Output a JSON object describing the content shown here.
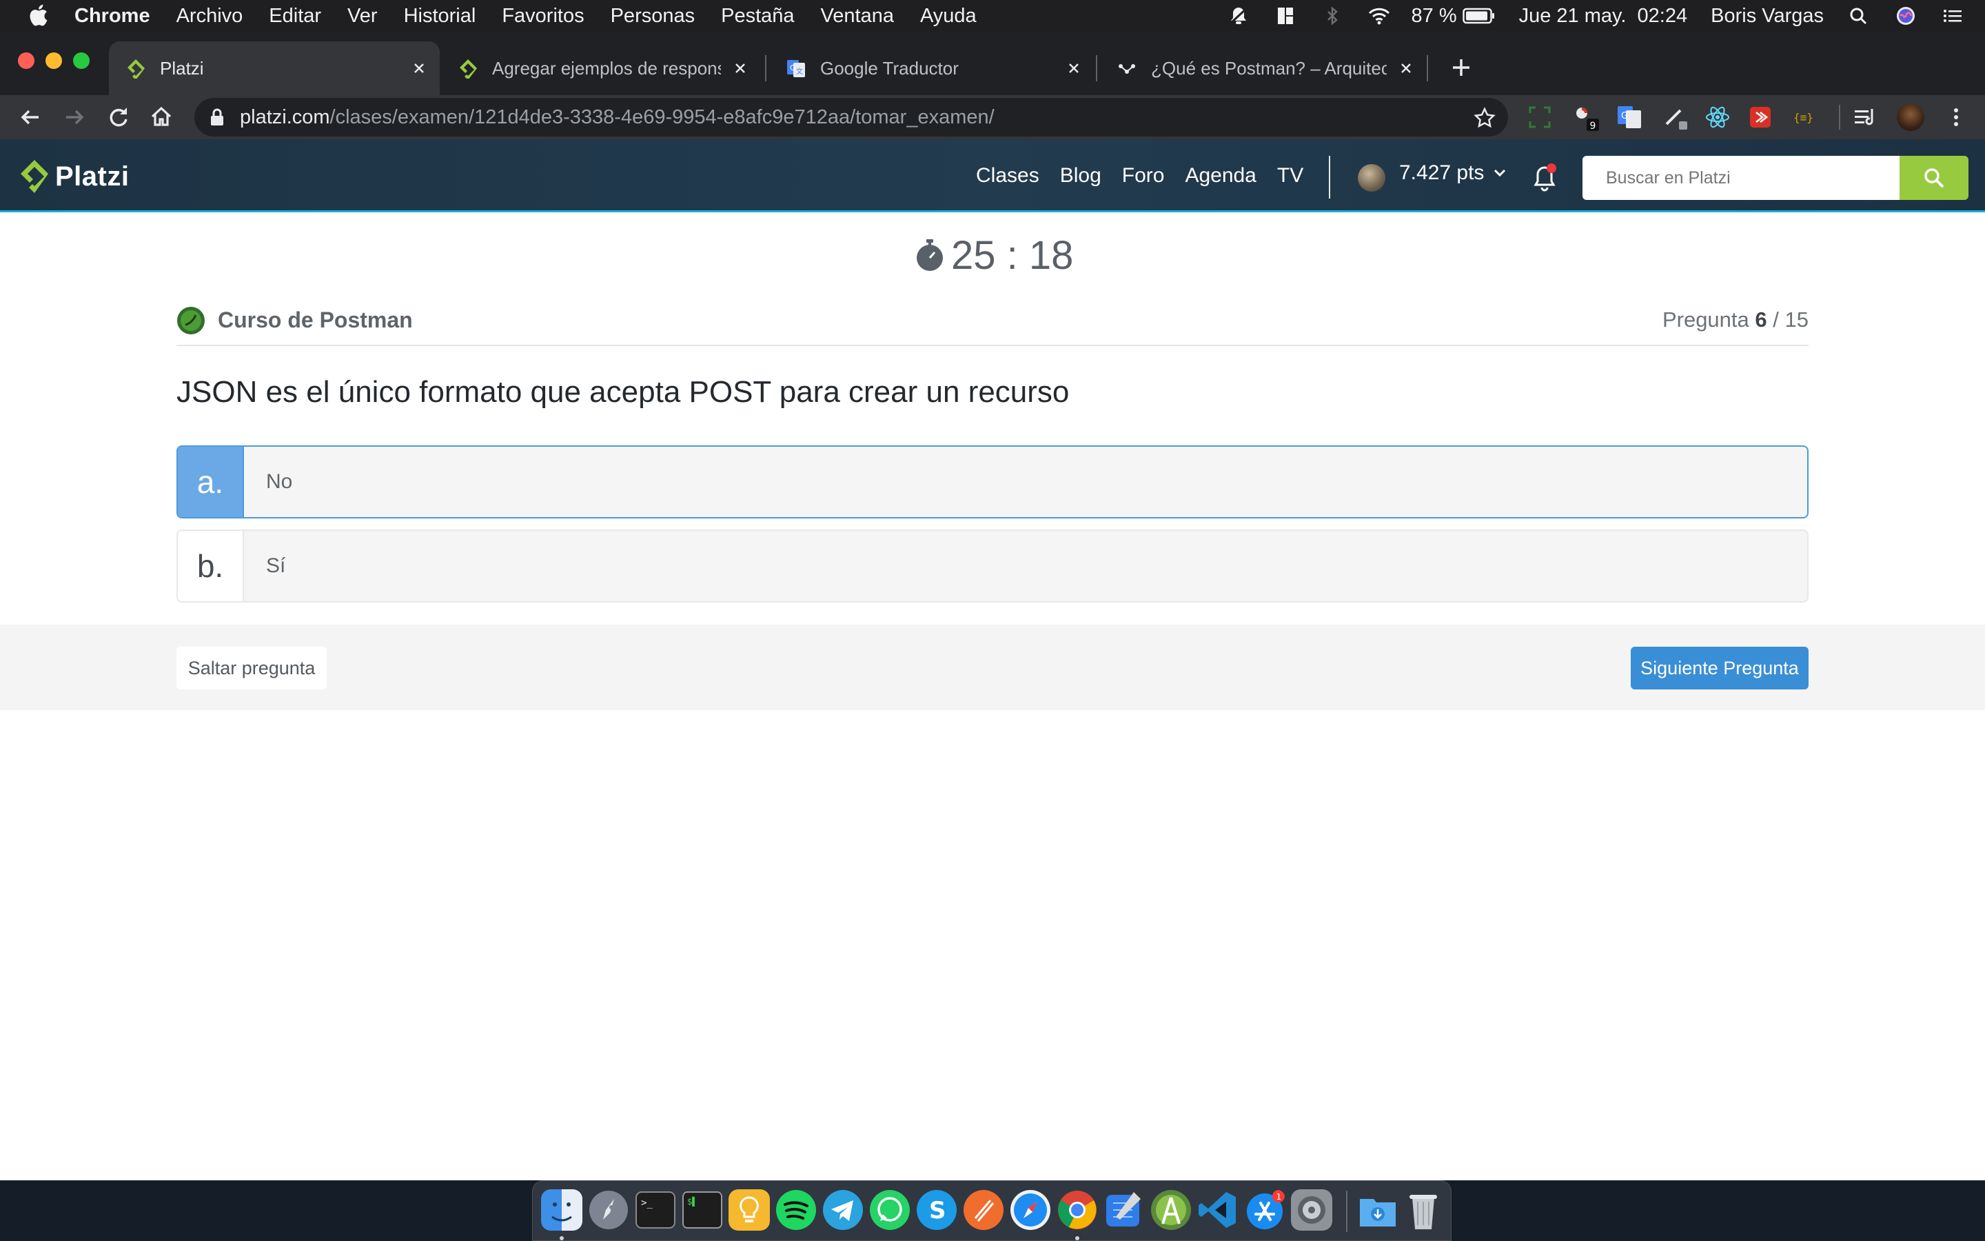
{
  "menubar": {
    "app_name": "Chrome",
    "menus": [
      "Archivo",
      "Editar",
      "Ver",
      "Historial",
      "Favoritos",
      "Personas",
      "Pestaña",
      "Ventana",
      "Ayuda"
    ],
    "battery": "87 %",
    "datetime": "Jue 21 may.  02:24",
    "user": "Boris Vargas"
  },
  "browser": {
    "tabs": [
      {
        "title": "Platzi",
        "icon": "platzi-icon",
        "active": true
      },
      {
        "title": "Agregar ejemplos de responses",
        "icon": "platzi-icon",
        "active": false
      },
      {
        "title": "Google Traductor",
        "icon": "google-translate-icon",
        "active": false
      },
      {
        "title": "¿Qué es Postman? – Arquitectura",
        "icon": "postman-icon",
        "active": false
      }
    ],
    "url_host": "platzi.com",
    "url_path": "/clases/examen/121d4de3-3338-4e69-9954-e8afc9e712aa/tomar_examen/",
    "extension_badge": "9"
  },
  "platzi_header": {
    "logo": "Platzi",
    "nav": [
      "Clases",
      "Blog",
      "Foro",
      "Agenda",
      "TV"
    ],
    "points": "7.427 pts",
    "search_placeholder": "Buscar en Platzi"
  },
  "exam": {
    "timer": "25 : 18",
    "course": "Curso de Postman",
    "question_label": "Pregunta",
    "question_current": "6",
    "question_total": "/ 15",
    "question": "JSON es el único formato que acepta POST para crear un recurso",
    "options": [
      {
        "letter": "a.",
        "text": "No",
        "selected": true
      },
      {
        "letter": "b.",
        "text": "Sí",
        "selected": false
      }
    ],
    "skip_label": "Saltar pregunta",
    "next_label": "Siguiente Pregunta"
  },
  "dock": {
    "apps": [
      "finder-icon",
      "launchpad-icon",
      "terminal-icon",
      "iterm-icon",
      "idea-icon",
      "spotify-icon",
      "telegram-icon",
      "whatsapp-icon",
      "skype-icon",
      "sublime-icon",
      "safari-icon",
      "chrome-icon",
      "xcode-icon",
      "android-studio-icon",
      "vscode-icon",
      "app-store-icon",
      "system-preferences-icon",
      "downloads-folder-icon",
      "trash-icon"
    ],
    "app_store_badge": "1"
  }
}
